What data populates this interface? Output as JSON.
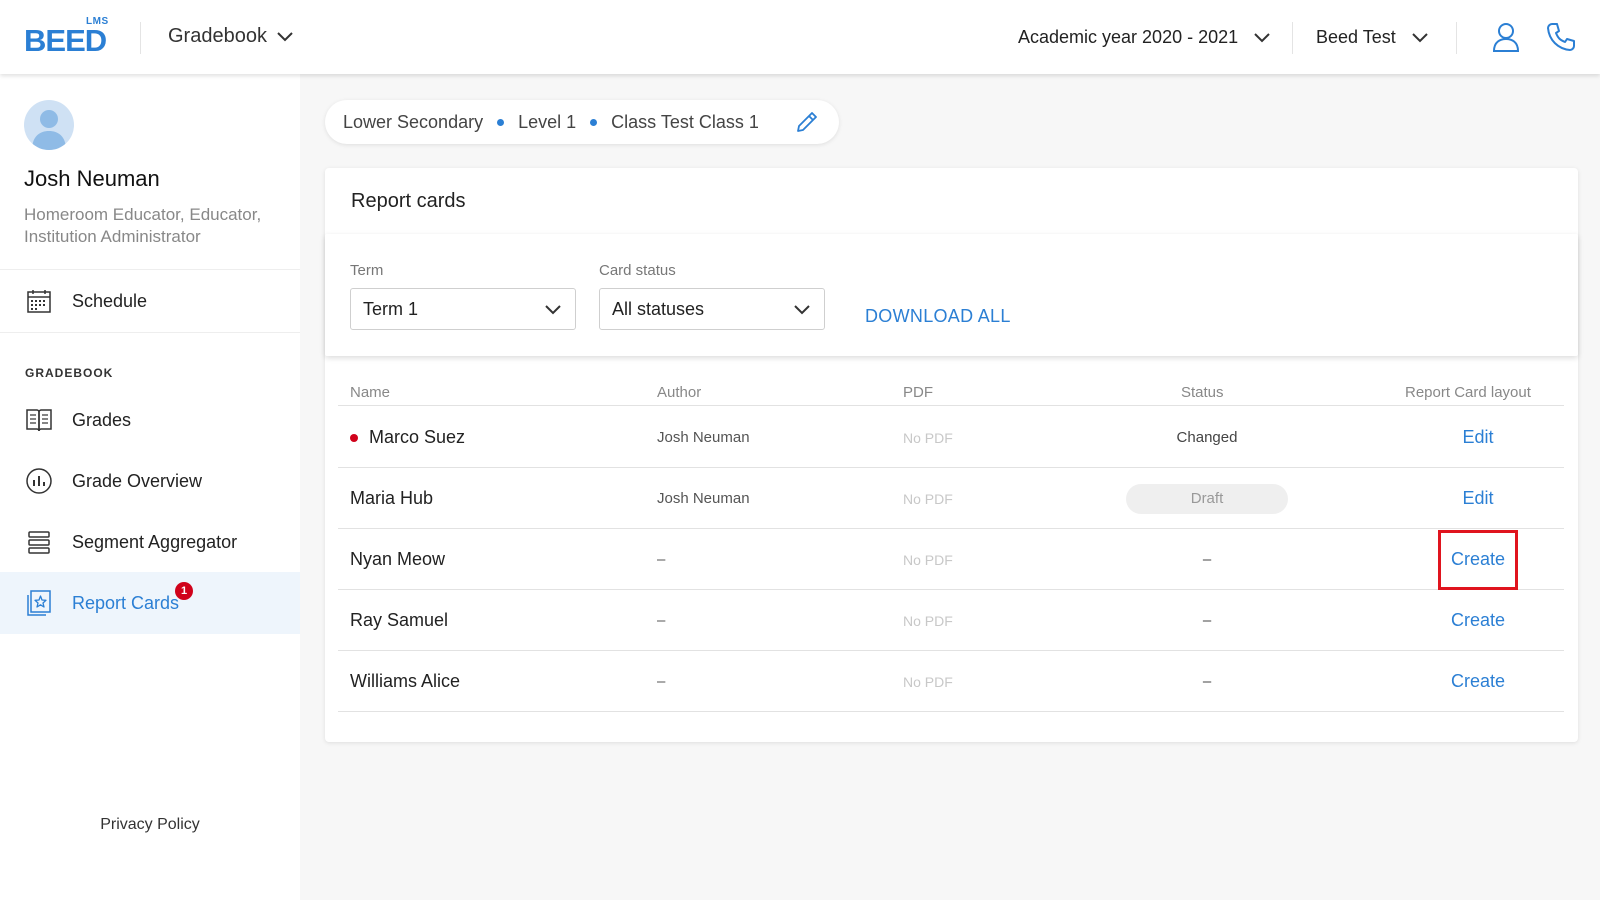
{
  "header": {
    "logo_small": "LMS",
    "logo_main": "BEED",
    "module": "Gradebook",
    "academic_year": "Academic year 2020 - 2021",
    "institution": "Beed Test"
  },
  "sidebar": {
    "user_name": "Josh Neuman",
    "user_roles": "Homeroom Educator, Educator, Institution Administrator",
    "schedule_label": "Schedule",
    "section_label": "GRADEBOOK",
    "items": [
      {
        "label": "Grades"
      },
      {
        "label": "Grade Overview"
      },
      {
        "label": "Segment Aggregator"
      },
      {
        "label": "Report Cards",
        "badge": "1"
      }
    ],
    "privacy": "Privacy Policy"
  },
  "breadcrumb": {
    "level_group": "Lower Secondary",
    "level": "Level 1",
    "class": "Class Test Class 1"
  },
  "report_cards": {
    "title": "Report cards",
    "term_label": "Term",
    "term_value": "Term 1",
    "status_label": "Card status",
    "status_value": "All statuses",
    "download_all": "DOWNLOAD ALL",
    "columns": {
      "name": "Name",
      "author": "Author",
      "pdf": "PDF",
      "status": "Status",
      "layout": "Report Card layout"
    },
    "rows": [
      {
        "name": "Marco Suez",
        "author": "Josh Neuman",
        "pdf": "No PDF",
        "status": "Changed",
        "action": "Edit"
      },
      {
        "name": "Maria Hub",
        "author": "Josh Neuman",
        "pdf": "No PDF",
        "status": "Draft",
        "action": "Edit"
      },
      {
        "name": "Nyan Meow",
        "author": "–",
        "pdf": "No PDF",
        "status": "–",
        "action": "Create"
      },
      {
        "name": "Ray Samuel",
        "author": "–",
        "pdf": "No PDF",
        "status": "–",
        "action": "Create"
      },
      {
        "name": "Williams Alice",
        "author": "–",
        "pdf": "No PDF",
        "status": "–",
        "action": "Create"
      }
    ]
  },
  "colors": {
    "accent": "#2b7fd4",
    "alert": "#d0021b",
    "highlight_box": "#e0141e"
  }
}
